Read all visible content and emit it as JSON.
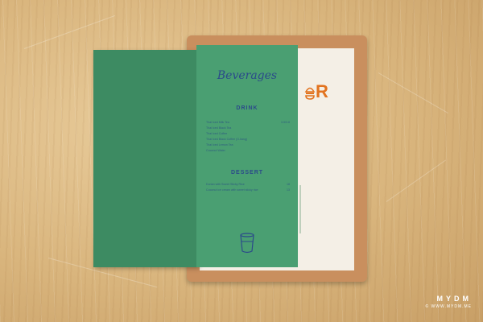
{
  "menu": {
    "title": "Beverages",
    "drinks_heading": "DRINK",
    "drink_items": [
      {
        "name": "Thai Iced Milk Tea",
        "price": "3.5/3.8"
      },
      {
        "name": "Thai Iced Black Tea",
        "price": ""
      },
      {
        "name": "Thai Iced Coffee",
        "price": ""
      },
      {
        "name": "Thai Iced Black Coffee (O-liang)",
        "price": ""
      },
      {
        "name": "Thai Iced Lemon Tea",
        "price": ""
      },
      {
        "name": "Coconut Water",
        "price": ""
      }
    ],
    "dessert_heading": "DESSERT",
    "dessert_items": [
      {
        "name": "Durian with Sweet Sticky Rice",
        "price": "18"
      },
      {
        "name": "Coconut ice cream with sweet sticky rice",
        "price": "13"
      }
    ]
  },
  "logo": {
    "letter": "R",
    "accent": "#e2731f"
  },
  "colors": {
    "panel": "#4a9f72",
    "flap": "#3d8b62",
    "ink": "#2b4a8a",
    "board": "#c98f5e"
  },
  "watermark": {
    "brand": "MYDM",
    "site": "© WWW.MYDM.ME"
  }
}
